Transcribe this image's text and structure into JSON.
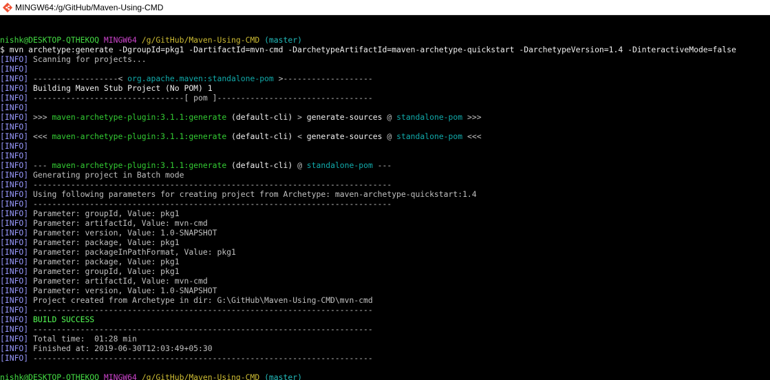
{
  "window": {
    "title": "MINGW64:/g/GitHub/Maven-Using-CMD"
  },
  "colors": {
    "tag": "#9999ff",
    "plugin_green": "#33cc33",
    "cyan": "#11aaaa",
    "success_green": "#55ff55",
    "host_magenta": "#cc44cc",
    "path_yellow": "#ccbb33",
    "background": "#000000"
  },
  "icons": {
    "app": "git-bash-diamond-icon"
  },
  "lines": [
    {
      "spans": []
    },
    {
      "spans": [
        {
          "t": "nishk@DESKTOP-QTHEKOQ",
          "c": "user"
        },
        {
          "t": " "
        },
        {
          "t": "MINGW64",
          "c": "host"
        },
        {
          "t": " "
        },
        {
          "t": "/g/GitHub/Maven-Using-CMD",
          "c": "path"
        },
        {
          "t": " "
        },
        {
          "t": "(master)",
          "c": "branch"
        }
      ]
    },
    {
      "spans": [
        {
          "t": "$ mvn archetype:generate -DgroupId=pkg1 -DartifactId=mvn-cmd -DarchetypeArtifactId=maven-archetype-quickstart -DarchetypeVersion=1.4 -DinteractiveMode=false",
          "c": "white"
        }
      ]
    },
    {
      "spans": [
        {
          "t": "[INFO]",
          "c": "tag"
        },
        {
          "t": " Scanning for projects..."
        }
      ]
    },
    {
      "spans": [
        {
          "t": "[INFO]",
          "c": "tag"
        }
      ]
    },
    {
      "spans": [
        {
          "t": "[INFO]",
          "c": "tag"
        },
        {
          "t": " ------------------< "
        },
        {
          "t": "org.apache.maven:standalone-pom",
          "c": "cyan"
        },
        {
          "t": " >-------------------"
        }
      ]
    },
    {
      "spans": [
        {
          "t": "[INFO]",
          "c": "tag"
        },
        {
          "t": " Building Maven Stub Project (No POM) 1",
          "c": "white"
        }
      ]
    },
    {
      "spans": [
        {
          "t": "[INFO]",
          "c": "tag"
        },
        {
          "t": " --------------------------------[ pom ]---------------------------------"
        }
      ]
    },
    {
      "spans": [
        {
          "t": "[INFO]",
          "c": "tag"
        }
      ]
    },
    {
      "spans": [
        {
          "t": "[INFO]",
          "c": "tag"
        },
        {
          "t": " >>> "
        },
        {
          "t": "maven-archetype-plugin:3.1.1:generate",
          "c": "green"
        },
        {
          "t": " (default-cli)",
          "c": "white"
        },
        {
          "t": " > "
        },
        {
          "t": "generate-sources",
          "c": "white"
        },
        {
          "t": " @ "
        },
        {
          "t": "standalone-pom",
          "c": "cyan"
        },
        {
          "t": " >>>"
        }
      ]
    },
    {
      "spans": [
        {
          "t": "[INFO]",
          "c": "tag"
        }
      ]
    },
    {
      "spans": [
        {
          "t": "[INFO]",
          "c": "tag"
        },
        {
          "t": " <<< "
        },
        {
          "t": "maven-archetype-plugin:3.1.1:generate",
          "c": "green"
        },
        {
          "t": " (default-cli)",
          "c": "white"
        },
        {
          "t": " < "
        },
        {
          "t": "generate-sources",
          "c": "white"
        },
        {
          "t": " @ "
        },
        {
          "t": "standalone-pom",
          "c": "cyan"
        },
        {
          "t": " <<<"
        }
      ]
    },
    {
      "spans": [
        {
          "t": "[INFO]",
          "c": "tag"
        }
      ]
    },
    {
      "spans": [
        {
          "t": "[INFO]",
          "c": "tag"
        }
      ]
    },
    {
      "spans": [
        {
          "t": "[INFO]",
          "c": "tag"
        },
        {
          "t": " --- "
        },
        {
          "t": "maven-archetype-plugin:3.1.1:generate",
          "c": "green"
        },
        {
          "t": " (default-cli)",
          "c": "white"
        },
        {
          "t": " @ "
        },
        {
          "t": "standalone-pom",
          "c": "cyan"
        },
        {
          "t": " ---"
        }
      ]
    },
    {
      "spans": [
        {
          "t": "[INFO]",
          "c": "tag"
        },
        {
          "t": " Generating project in Batch mode"
        }
      ]
    },
    {
      "spans": [
        {
          "t": "[INFO]",
          "c": "tag"
        },
        {
          "t": " ----------------------------------------------------------------------------"
        }
      ]
    },
    {
      "spans": [
        {
          "t": "[INFO]",
          "c": "tag"
        },
        {
          "t": " Using following parameters for creating project from Archetype: maven-archetype-quickstart:1.4"
        }
      ]
    },
    {
      "spans": [
        {
          "t": "[INFO]",
          "c": "tag"
        },
        {
          "t": " ----------------------------------------------------------------------------"
        }
      ]
    },
    {
      "spans": [
        {
          "t": "[INFO]",
          "c": "tag"
        },
        {
          "t": " Parameter: groupId, Value: pkg1"
        }
      ]
    },
    {
      "spans": [
        {
          "t": "[INFO]",
          "c": "tag"
        },
        {
          "t": " Parameter: artifactId, Value: mvn-cmd"
        }
      ]
    },
    {
      "spans": [
        {
          "t": "[INFO]",
          "c": "tag"
        },
        {
          "t": " Parameter: version, Value: 1.0-SNAPSHOT"
        }
      ]
    },
    {
      "spans": [
        {
          "t": "[INFO]",
          "c": "tag"
        },
        {
          "t": " Parameter: package, Value: pkg1"
        }
      ]
    },
    {
      "spans": [
        {
          "t": "[INFO]",
          "c": "tag"
        },
        {
          "t": " Parameter: packageInPathFormat, Value: pkg1"
        }
      ]
    },
    {
      "spans": [
        {
          "t": "[INFO]",
          "c": "tag"
        },
        {
          "t": " Parameter: package, Value: pkg1"
        }
      ]
    },
    {
      "spans": [
        {
          "t": "[INFO]",
          "c": "tag"
        },
        {
          "t": " Parameter: groupId, Value: pkg1"
        }
      ]
    },
    {
      "spans": [
        {
          "t": "[INFO]",
          "c": "tag"
        },
        {
          "t": " Parameter: artifactId, Value: mvn-cmd"
        }
      ]
    },
    {
      "spans": [
        {
          "t": "[INFO]",
          "c": "tag"
        },
        {
          "t": " Parameter: version, Value: 1.0-SNAPSHOT"
        }
      ]
    },
    {
      "spans": [
        {
          "t": "[INFO]",
          "c": "tag"
        },
        {
          "t": " Project created from Archetype in dir: G:\\GitHub\\Maven-Using-CMD\\mvn-cmd"
        }
      ]
    },
    {
      "spans": [
        {
          "t": "[INFO]",
          "c": "tag"
        },
        {
          "t": " ------------------------------------------------------------------------"
        }
      ]
    },
    {
      "spans": [
        {
          "t": "[INFO]",
          "c": "tag"
        },
        {
          "t": " "
        },
        {
          "t": "BUILD SUCCESS",
          "c": "ok"
        }
      ]
    },
    {
      "spans": [
        {
          "t": "[INFO]",
          "c": "tag"
        },
        {
          "t": " ------------------------------------------------------------------------"
        }
      ]
    },
    {
      "spans": [
        {
          "t": "[INFO]",
          "c": "tag"
        },
        {
          "t": " Total time:  01:28 min"
        }
      ]
    },
    {
      "spans": [
        {
          "t": "[INFO]",
          "c": "tag"
        },
        {
          "t": " Finished at: 2019-06-30T12:03:49+05:30"
        }
      ]
    },
    {
      "spans": [
        {
          "t": "[INFO]",
          "c": "tag"
        },
        {
          "t": " ------------------------------------------------------------------------"
        }
      ]
    },
    {
      "spans": []
    },
    {
      "spans": [
        {
          "t": "nishk@DESKTOP-QTHEKOQ",
          "c": "user"
        },
        {
          "t": " "
        },
        {
          "t": "MINGW64",
          "c": "host"
        },
        {
          "t": " "
        },
        {
          "t": "/g/GitHub/Maven-Using-CMD",
          "c": "path"
        },
        {
          "t": " "
        },
        {
          "t": "(master)",
          "c": "branch"
        }
      ]
    },
    {
      "spans": [
        {
          "t": "$",
          "c": "white"
        }
      ]
    }
  ]
}
